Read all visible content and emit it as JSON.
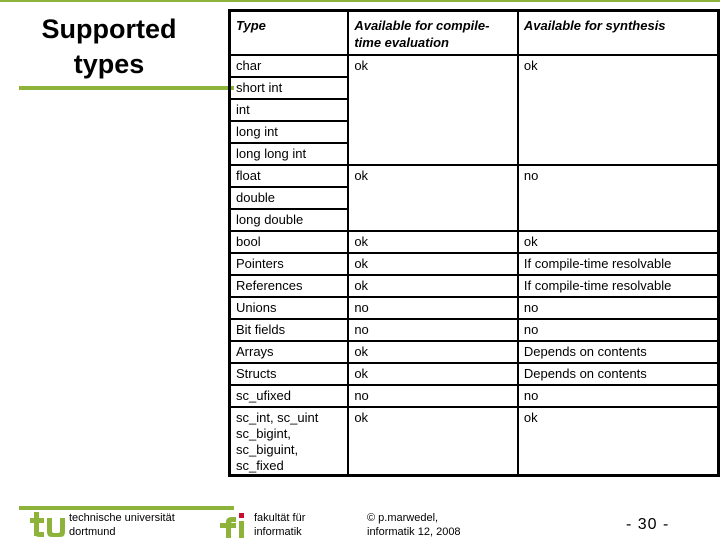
{
  "slide": {
    "title_line1": "Supported",
    "title_line2": "types",
    "brand_color": "#8db33a"
  },
  "table": {
    "headers": [
      "Type",
      "Available for  compile-time evaluation",
      "Available for synthesis"
    ],
    "rows": [
      {
        "types": [
          "char",
          "short int",
          "int",
          "long int",
          "long long int"
        ],
        "compile_time": "ok",
        "synthesis": "ok"
      },
      {
        "types": [
          "float",
          "double",
          "long double"
        ],
        "compile_time": "ok",
        "synthesis": "no"
      },
      {
        "types": [
          "bool"
        ],
        "compile_time": "ok",
        "synthesis": "ok"
      },
      {
        "types": [
          "Pointers"
        ],
        "compile_time": "ok",
        "synthesis": "If compile-time resolvable"
      },
      {
        "types": [
          "References"
        ],
        "compile_time": "ok",
        "synthesis": "If compile-time resolvable"
      },
      {
        "types": [
          "Unions"
        ],
        "compile_time": "no",
        "synthesis": "no"
      },
      {
        "types": [
          "Bit fields"
        ],
        "compile_time": "no",
        "synthesis": "no"
      },
      {
        "types": [
          "Arrays"
        ],
        "compile_time": "ok",
        "synthesis": "Depends on contents"
      },
      {
        "types": [
          "Structs"
        ],
        "compile_time": "ok",
        "synthesis": "Depends on contents"
      },
      {
        "types": [
          "sc_ufixed"
        ],
        "compile_time": "no",
        "synthesis": "no"
      },
      {
        "types": [
          "sc_int, sc_uint sc_bigint, sc_biguint, sc_fixed"
        ],
        "compile_time": "ok",
        "synthesis": "ok"
      }
    ]
  },
  "footer": {
    "university_line1": "technische universität",
    "university_line2": "dortmund",
    "faculty_line1": "fakultät für",
    "faculty_line2": "informatik",
    "copyright_line1": "© p.marwedel,",
    "copyright_line2": "informatik 12,  2008",
    "page_number": "-  30 -",
    "logo_accent": "#c8102e"
  }
}
